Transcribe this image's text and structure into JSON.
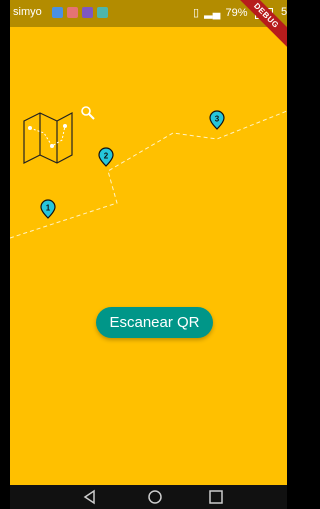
{
  "status_bar": {
    "carrier": "simyo",
    "battery_percent": "79%",
    "time": "5"
  },
  "debug_banner": {
    "label": "DEBUG"
  },
  "map": {
    "markers": [
      {
        "label": "1"
      },
      {
        "label": "2"
      },
      {
        "label": "3"
      }
    ]
  },
  "actions": {
    "scan_label": "Escanear QR"
  },
  "colors": {
    "background": "#FFC000",
    "button": "#009688",
    "marker": "#26C6DA"
  }
}
